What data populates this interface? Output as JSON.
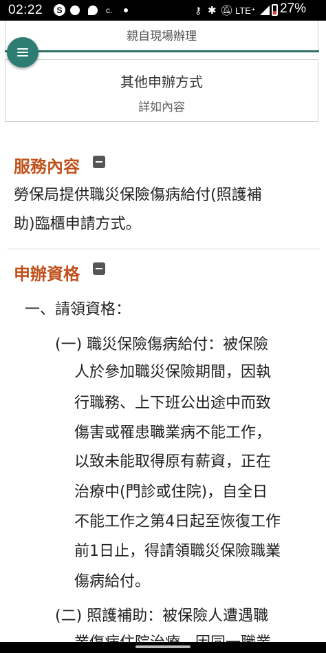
{
  "status_bar": {
    "time": "02:22",
    "s_badge": "S",
    "c_label": "c.",
    "lte": "LTE⁺",
    "battery": "27%",
    "icons": [
      "skype-icon",
      "chat-icon",
      "messenger-icon",
      "key-icon",
      "bluetooth-icon",
      "mute-icon",
      "signal-icon",
      "battery-icon"
    ]
  },
  "top_card": {
    "text": "親自現場辦理"
  },
  "menu": {
    "icon": "menu-icon"
  },
  "other_card": {
    "title": "其他申辦方式",
    "subtitle": "詳如內容"
  },
  "service_content": {
    "heading": "服務內容",
    "line1": "勞保局提供職災保險傷病給付(照護補",
    "line2": "助)臨櫃申請方式。"
  },
  "eligibility": {
    "heading": "申辦資格",
    "item1_title": "一、請領資格：",
    "sub1": [
      "(一) 職災保險傷病給付：被保險",
      "人於參加職災保險期間，因執",
      "行職務、上下班公出途中而致",
      "傷害或罹患職業病不能工作，",
      "以致未能取得原有薪資，正在",
      "治療中(門診或住院)，自全日",
      "不能工作之第4日起至恢復工作",
      "前1日止，得請領職災保險職業",
      "傷病給付。"
    ],
    "sub2": [
      "(二) 照護補助：被保險人遭遇職",
      "業傷病住院治療，因同一職業"
    ]
  },
  "colors": {
    "accent": "#2e7d73",
    "heading": "#c0501a"
  }
}
